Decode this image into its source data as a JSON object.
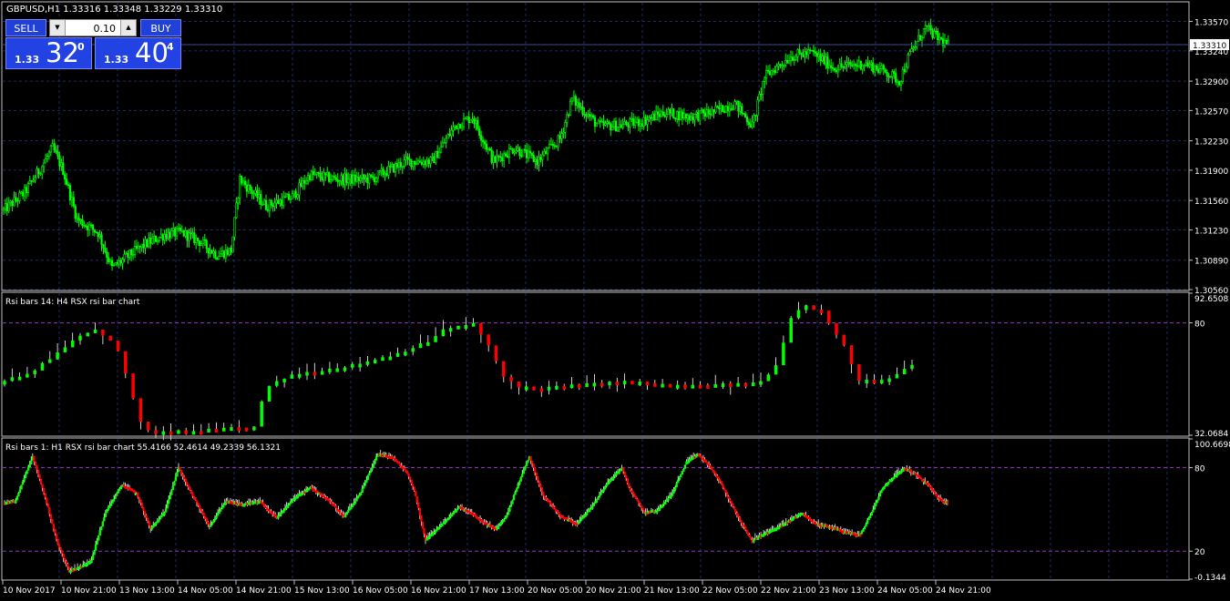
{
  "window": {
    "symbol_header": "GBPUSD,H1  1.33316 1.33348 1.33229 1.33310"
  },
  "one_click": {
    "sell_label": "SELL",
    "buy_label": "BUY",
    "lot": "0.10",
    "sell_small": "1.33",
    "sell_big": "32",
    "sell_sup": "0",
    "buy_small": "1.33",
    "buy_big": "40",
    "buy_sup": "4"
  },
  "colors": {
    "bull": "#00ff00",
    "bear": "#ff0000",
    "grid": "#1c2a62",
    "level": "#9a32c8",
    "frame": "#c0c0c0",
    "button": "#2242e4"
  },
  "chart_data": [
    {
      "type": "candlestick",
      "title": "GBPUSD,H1  1.33316 1.33348 1.33229 1.33310",
      "ylim": [
        1.3056,
        1.3378
      ],
      "yticks": [
        "1.33570",
        "1.33240",
        "1.32900",
        "1.32570",
        "1.32230",
        "1.31900",
        "1.31560",
        "1.31230",
        "1.30890",
        "1.30560"
      ],
      "current_price": "1.33310",
      "grid": true,
      "anchors": [
        [
          0,
          1.3145
        ],
        [
          12,
          1.3165
        ],
        [
          22,
          1.3195
        ],
        [
          28,
          1.3215
        ],
        [
          34,
          1.319
        ],
        [
          42,
          1.3135
        ],
        [
          54,
          1.312
        ],
        [
          62,
          1.308
        ],
        [
          72,
          1.3095
        ],
        [
          82,
          1.3108
        ],
        [
          92,
          1.3118
        ],
        [
          102,
          1.312
        ],
        [
          112,
          1.311
        ],
        [
          122,
          1.3095
        ],
        [
          130,
          1.31
        ],
        [
          135,
          1.318
        ],
        [
          150,
          1.315
        ],
        [
          165,
          1.316
        ],
        [
          175,
          1.3185
        ],
        [
          190,
          1.318
        ],
        [
          210,
          1.318
        ],
        [
          230,
          1.32
        ],
        [
          245,
          1.32
        ],
        [
          258,
          1.324
        ],
        [
          268,
          1.325
        ],
        [
          280,
          1.32
        ],
        [
          292,
          1.3215
        ],
        [
          305,
          1.32
        ],
        [
          318,
          1.3225
        ],
        [
          325,
          1.327
        ],
        [
          340,
          1.324
        ],
        [
          352,
          1.324
        ],
        [
          365,
          1.3245
        ],
        [
          378,
          1.3255
        ],
        [
          392,
          1.325
        ],
        [
          405,
          1.3255
        ],
        [
          418,
          1.3265
        ],
        [
          428,
          1.324
        ],
        [
          435,
          1.3295
        ],
        [
          450,
          1.3318
        ],
        [
          462,
          1.3322
        ],
        [
          475,
          1.3305
        ],
        [
          492,
          1.331
        ],
        [
          505,
          1.33
        ],
        [
          512,
          1.329
        ],
        [
          518,
          1.332
        ],
        [
          527,
          1.335
        ],
        [
          533,
          1.334
        ],
        [
          540,
          1.333
        ]
      ]
    },
    {
      "type": "bar",
      "title": "Rsi bars 14: H4 RSX rsi bar chart",
      "ylim": [
        32.0684,
        92.6508
      ],
      "yticks": [
        "92.6508",
        "80",
        "32.0684"
      ],
      "levels": [
        80
      ],
      "anchors": [
        [
          0,
          55
        ],
        [
          4,
          60
        ],
        [
          8,
          70
        ],
        [
          10,
          75
        ],
        [
          12,
          77
        ],
        [
          13,
          75
        ],
        [
          14,
          72
        ],
        [
          15,
          68
        ],
        [
          16,
          58
        ],
        [
          17,
          48
        ],
        [
          18,
          38
        ],
        [
          19,
          34
        ],
        [
          20,
          33
        ],
        [
          22,
          33.5
        ],
        [
          26,
          34
        ],
        [
          30,
          35
        ],
        [
          33,
          35.5
        ],
        [
          34,
          46
        ],
        [
          35,
          53
        ],
        [
          38,
          58
        ],
        [
          42,
          60
        ],
        [
          46,
          62
        ],
        [
          52,
          67
        ],
        [
          56,
          72
        ],
        [
          58,
          77
        ],
        [
          61,
          79
        ],
        [
          62,
          80
        ],
        [
          63,
          75
        ],
        [
          64,
          70
        ],
        [
          66,
          57
        ],
        [
          68,
          53
        ],
        [
          70,
          52
        ],
        [
          74,
          53
        ],
        [
          78,
          54
        ],
        [
          82,
          55
        ],
        [
          86,
          54
        ],
        [
          90,
          53
        ],
        [
          94,
          53.5
        ],
        [
          98,
          54
        ],
        [
          100,
          55
        ],
        [
          102,
          62
        ],
        [
          103,
          72
        ],
        [
          104,
          82
        ],
        [
          105,
          86
        ],
        [
          106,
          88
        ],
        [
          107,
          86
        ],
        [
          108,
          85
        ],
        [
          109,
          80
        ],
        [
          110,
          75
        ],
        [
          111,
          70
        ],
        [
          112,
          62
        ],
        [
          113,
          56
        ],
        [
          115,
          55
        ],
        [
          117,
          56
        ],
        [
          118,
          58
        ],
        [
          119,
          60
        ],
        [
          120,
          62
        ]
      ],
      "bars_up_to": 120
    },
    {
      "type": "bar",
      "title": "Rsi bars 1: H1 RSX rsi bar chart 55.4166 52.4614 49.2339 56.1321",
      "ylim": [
        -0.1344,
        100.6698
      ],
      "yticks": [
        "100.6698",
        "80",
        "20",
        "-0.1344"
      ],
      "levels": [
        80,
        20
      ],
      "anchors": [
        [
          0,
          55
        ],
        [
          8,
          57
        ],
        [
          20,
          88
        ],
        [
          28,
          62
        ],
        [
          38,
          25
        ],
        [
          46,
          6
        ],
        [
          56,
          10
        ],
        [
          62,
          14
        ],
        [
          72,
          48
        ],
        [
          84,
          68
        ],
        [
          94,
          62
        ],
        [
          104,
          36
        ],
        [
          114,
          48
        ],
        [
          124,
          80
        ],
        [
          134,
          60
        ],
        [
          146,
          38
        ],
        [
          158,
          56
        ],
        [
          170,
          54
        ],
        [
          182,
          56
        ],
        [
          194,
          44
        ],
        [
          206,
          58
        ],
        [
          218,
          66
        ],
        [
          230,
          58
        ],
        [
          242,
          45
        ],
        [
          254,
          62
        ],
        [
          266,
          90
        ],
        [
          276,
          88
        ],
        [
          286,
          78
        ],
        [
          292,
          64
        ],
        [
          300,
          28
        ],
        [
          312,
          40
        ],
        [
          324,
          52
        ],
        [
          332,
          48
        ],
        [
          340,
          42
        ],
        [
          350,
          36
        ],
        [
          358,
          46
        ],
        [
          366,
          68
        ],
        [
          374,
          88
        ],
        [
          384,
          60
        ],
        [
          396,
          46
        ],
        [
          408,
          40
        ],
        [
          420,
          54
        ],
        [
          430,
          70
        ],
        [
          440,
          80
        ],
        [
          446,
          64
        ],
        [
          456,
          48
        ],
        [
          466,
          50
        ],
        [
          476,
          62
        ],
        [
          486,
          84
        ],
        [
          494,
          90
        ],
        [
          502,
          82
        ],
        [
          510,
          70
        ],
        [
          520,
          50
        ],
        [
          532,
          28
        ],
        [
          544,
          34
        ],
        [
          556,
          40
        ],
        [
          568,
          48
        ],
        [
          578,
          40
        ],
        [
          588,
          38
        ],
        [
          600,
          34
        ],
        [
          610,
          32
        ],
        [
          618,
          48
        ],
        [
          626,
          66
        ],
        [
          634,
          74
        ],
        [
          642,
          80
        ],
        [
          650,
          75
        ],
        [
          658,
          68
        ],
        [
          666,
          58
        ],
        [
          672,
          55
        ]
      ],
      "bars_up_to": 672
    }
  ],
  "time_axis": {
    "labels": [
      "10 Nov 2017",
      "10 Nov 21:00",
      "13 Nov 13:00",
      "14 Nov 05:00",
      "14 Nov 21:00",
      "15 Nov 13:00",
      "16 Nov 05:00",
      "16 Nov 21:00",
      "17 Nov 13:00",
      "20 Nov 05:00",
      "20 Nov 21:00",
      "21 Nov 13:00",
      "22 Nov 05:00",
      "22 Nov 21:00",
      "23 Nov 13:00",
      "24 Nov 05:00",
      "24 Nov 21:00"
    ]
  }
}
